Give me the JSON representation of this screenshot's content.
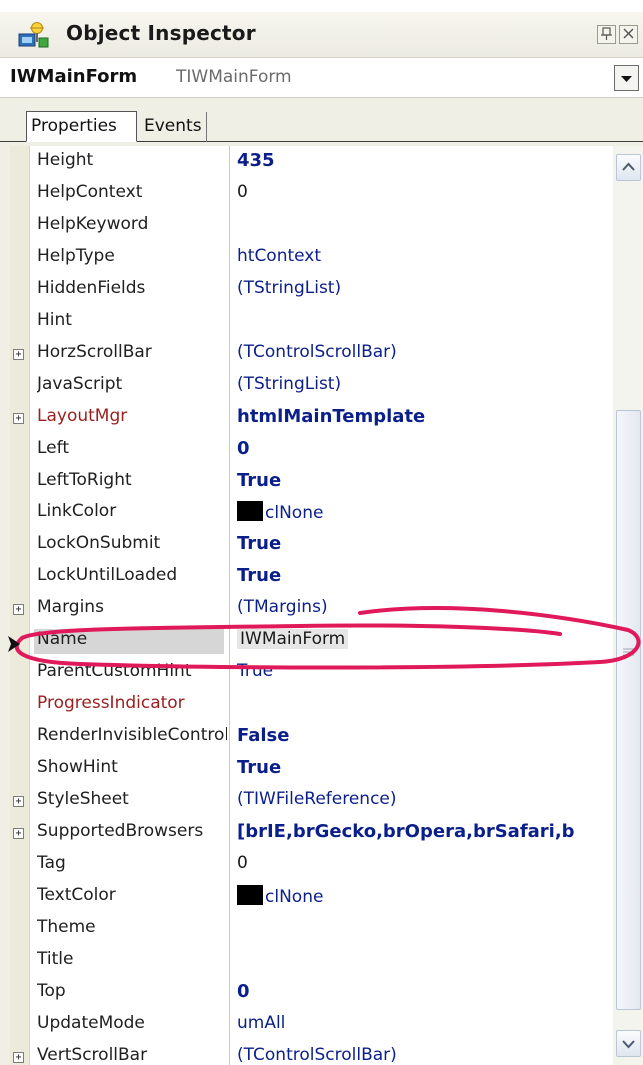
{
  "window": {
    "title": "Object Inspector",
    "pin_icon": "pin-icon",
    "close_icon": "close-icon"
  },
  "selector": {
    "object_name": "IWMainForm",
    "object_class": "TIWMainForm"
  },
  "tabs": [
    {
      "label": "Properties",
      "active": true
    },
    {
      "label": "Events",
      "active": false
    }
  ],
  "properties": [
    {
      "name": "Height",
      "value": "435",
      "style": "bold",
      "expander": false
    },
    {
      "name": "HelpContext",
      "value": "0",
      "style": "plain",
      "expander": false
    },
    {
      "name": "HelpKeyword",
      "value": "",
      "style": "normal",
      "expander": false
    },
    {
      "name": "HelpType",
      "value": "htContext",
      "style": "normal",
      "expander": false
    },
    {
      "name": "HiddenFields",
      "value": "(TStringList)",
      "style": "normal",
      "expander": false
    },
    {
      "name": "Hint",
      "value": "",
      "style": "normal",
      "expander": false
    },
    {
      "name": "HorzScrollBar",
      "value": "(TControlScrollBar)",
      "style": "normal",
      "expander": true
    },
    {
      "name": "JavaScript",
      "value": "(TStringList)",
      "style": "normal",
      "expander": false
    },
    {
      "name": "LayoutMgr",
      "value": "htmlMainTemplate",
      "style": "bold",
      "expander": true,
      "name_color": "red"
    },
    {
      "name": "Left",
      "value": "0",
      "style": "bold",
      "expander": false
    },
    {
      "name": "LeftToRight",
      "value": "True",
      "style": "bold",
      "expander": false
    },
    {
      "name": "LinkColor",
      "value": "clNone",
      "style": "normal",
      "expander": false,
      "swatch": "#000000"
    },
    {
      "name": "LockOnSubmit",
      "value": "True",
      "style": "bold",
      "expander": false
    },
    {
      "name": "LockUntilLoaded",
      "value": "True",
      "style": "bold",
      "expander": false
    },
    {
      "name": "Margins",
      "value": "(TMargins)",
      "style": "normal",
      "expander": true
    },
    {
      "name": "Name",
      "value": "IWMainForm",
      "style": "normal",
      "expander": false,
      "selected": true
    },
    {
      "name": "ParentCustomHint",
      "value": "True",
      "style": "normal",
      "expander": false
    },
    {
      "name": "ProgressIndicator",
      "value": "",
      "style": "normal",
      "expander": false,
      "name_color": "red"
    },
    {
      "name": "RenderInvisibleControls",
      "value": "False",
      "style": "bold",
      "expander": false
    },
    {
      "name": "ShowHint",
      "value": "True",
      "style": "bold",
      "expander": false
    },
    {
      "name": "StyleSheet",
      "value": "(TIWFileReference)",
      "style": "normal",
      "expander": true
    },
    {
      "name": "SupportedBrowsers",
      "value": "[brIE,brGecko,brOpera,brSafari,b",
      "style": "bold",
      "expander": true
    },
    {
      "name": "Tag",
      "value": "0",
      "style": "plain",
      "expander": false
    },
    {
      "name": "TextColor",
      "value": "clNone",
      "style": "normal",
      "expander": false,
      "swatch": "#000000"
    },
    {
      "name": "Theme",
      "value": "",
      "style": "normal",
      "expander": false
    },
    {
      "name": "Title",
      "value": "",
      "style": "normal",
      "expander": false
    },
    {
      "name": "Top",
      "value": "0",
      "style": "bold",
      "expander": false
    },
    {
      "name": "UpdateMode",
      "value": "umAll",
      "style": "normal",
      "expander": false
    },
    {
      "name": "VertScrollBar",
      "value": "(TControlScrollBar)",
      "style": "normal",
      "expander": true
    }
  ],
  "colors": {
    "value_blue": "#0b1f8a",
    "annotation_red": "#e0195a",
    "modified_name_red": "#9b1e1e"
  }
}
